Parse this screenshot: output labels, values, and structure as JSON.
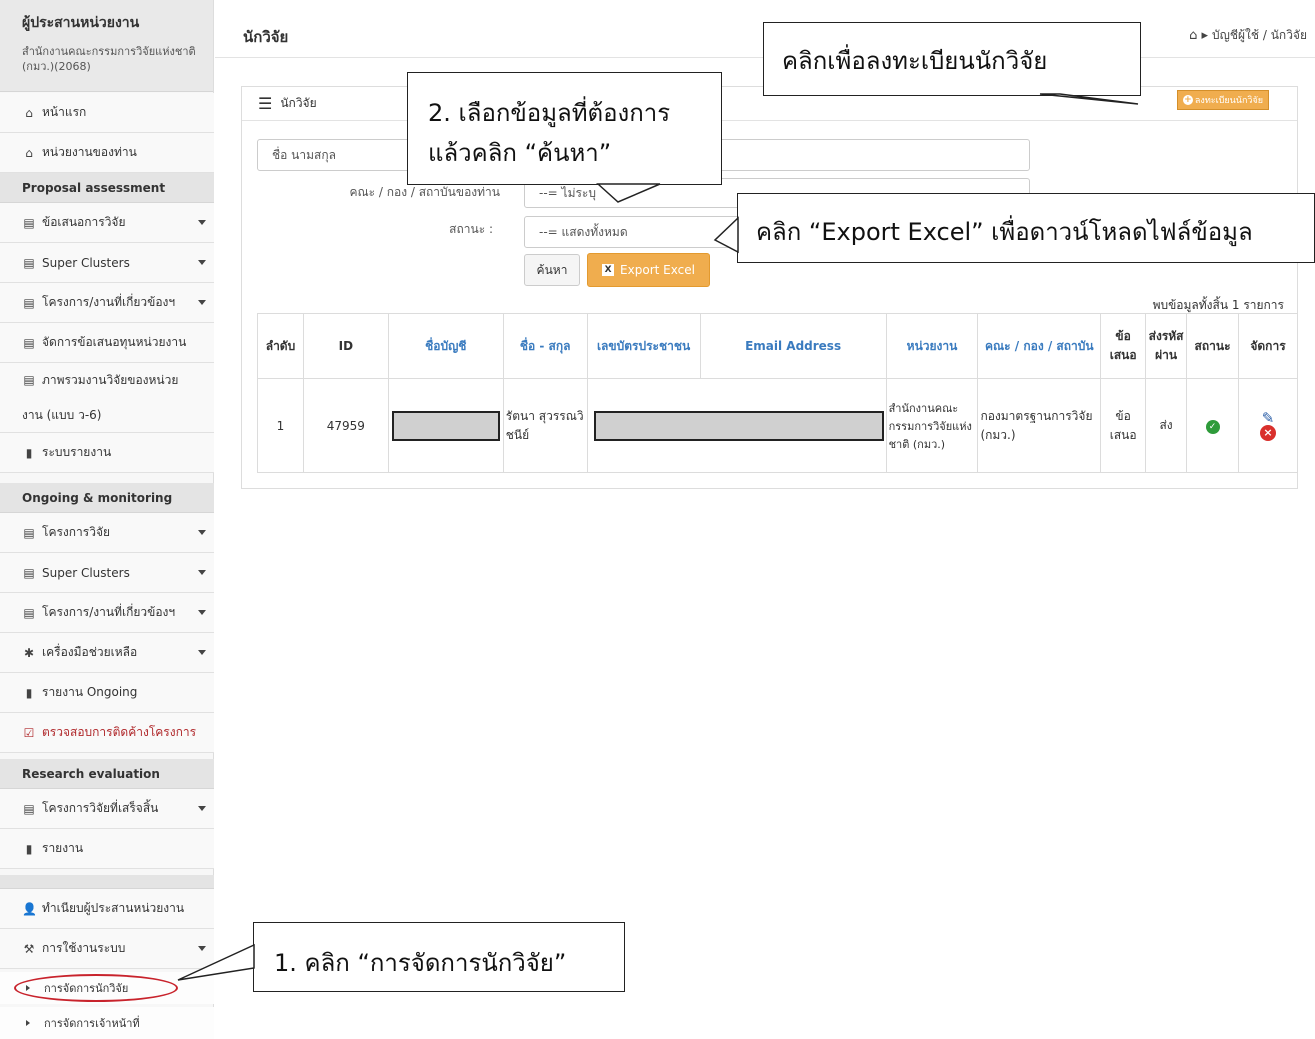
{
  "sidebar": {
    "org_role": "ผู้ประสานหน่วยงาน",
    "org_name": "สำนักงานคณะกรรมการวิจัยแห่งชาติ (กมว.)(2068)",
    "items": {
      "home": "หน้าแรก",
      "my_unit": "หน่วยงานของท่าน",
      "section_proposal": "Proposal assessment",
      "proposals": "ข้อเสนอการวิจัย",
      "super_clusters_1": "Super Clusters",
      "related_projects_1": "โครงการ/งานที่เกี่ยวข้องฯ",
      "manage_proposals": "จัดการข้อเสนอทุนหน่วยงาน",
      "overview": "ภาพรวมงานวิจัยของหน่วย",
      "overview_2": "งาน (แบบ ว-6)",
      "report_system": "ระบบรายงาน",
      "section_ongoing": "Ongoing & monitoring",
      "research_projects": "โครงการวิจัย",
      "super_clusters_2": "Super Clusters",
      "related_projects_2": "โครงการ/งานที่เกี่ยวข้องฯ",
      "tools": "เครื่องมือช่วยเหลือ",
      "ongoing_report": "รายงาน Ongoing",
      "check_pending": "ตรวจสอบการติดค้างโครงการ",
      "section_evaluation": "Research evaluation",
      "finished_projects": "โครงการวิจัยที่เสร็จสิ้น",
      "report": "รายงาน",
      "register_coordinator": "ทำเนียบผู้ประสานหน่วยงาน",
      "system_usage": "การใช้งานระบบ",
      "manage_researchers": "การจัดการนักวิจัย",
      "manage_staff": "การจัดการเจ้าหน้าที่"
    }
  },
  "header": {
    "title": "นักวิจัย",
    "breadcrumb": "บัญชีผู้ใช้ / นักวิจัย"
  },
  "panel": {
    "title": "นักวิจัย",
    "register_button": "ลงทะเบียนนักวิจัย"
  },
  "filters": {
    "name_placeholder": "ชื่อ นามสกุล",
    "faculty_label": "คณะ / กอง / สถาบันของท่าน",
    "faculty_value": "--= ไม่ระบุ",
    "status_label": "สถานะ :",
    "status_value": "--= แสดงทั้งหมด",
    "search_button": "ค้นหา",
    "export_button": "Export Excel"
  },
  "results": {
    "found_text": "พบข้อมูลทั้งสิ้น 1 รายการ",
    "columns": [
      "ลำดับ",
      "ID",
      "ชื่อบัญชี",
      "ชื่อ - สกุล",
      "เลขบัตรประชาชน",
      "Email Address",
      "หน่วยงาน",
      "คณะ / กอง / สถาบัน",
      "ข้อเสนอ",
      "ส่งรหัสผ่าน",
      "สถานะ",
      "จัดการ"
    ],
    "rows": [
      {
        "no": "1",
        "id": "47959",
        "name": "รัตนา สุวรรณวิชนีย์",
        "unit": "สำนักงานคณะกรรมการวิจัยแห่งชาติ (กมว.)",
        "faculty": "กองมาตรฐานการวิจัย (กมว.)",
        "proposal": "ข้อเสนอ",
        "send": "ส่ง"
      }
    ]
  },
  "annotations": {
    "register": "คลิกเพื่อลงทะเบียนนักวิจัย",
    "select_line1": "2. เลือกข้อมูลที่ต้องการ",
    "select_line2": "แล้วคลิก “ค้นหา”",
    "export": "คลิก “Export Excel” เพื่อดาวน์โหลดไฟล์ข้อมูล",
    "menu": "1. คลิก “การจัดการนักวิจัย”"
  },
  "colors": {
    "accent_orange": "#f0ad4e",
    "link_blue": "#3a7bbf",
    "highlight_red": "#c8232c"
  }
}
